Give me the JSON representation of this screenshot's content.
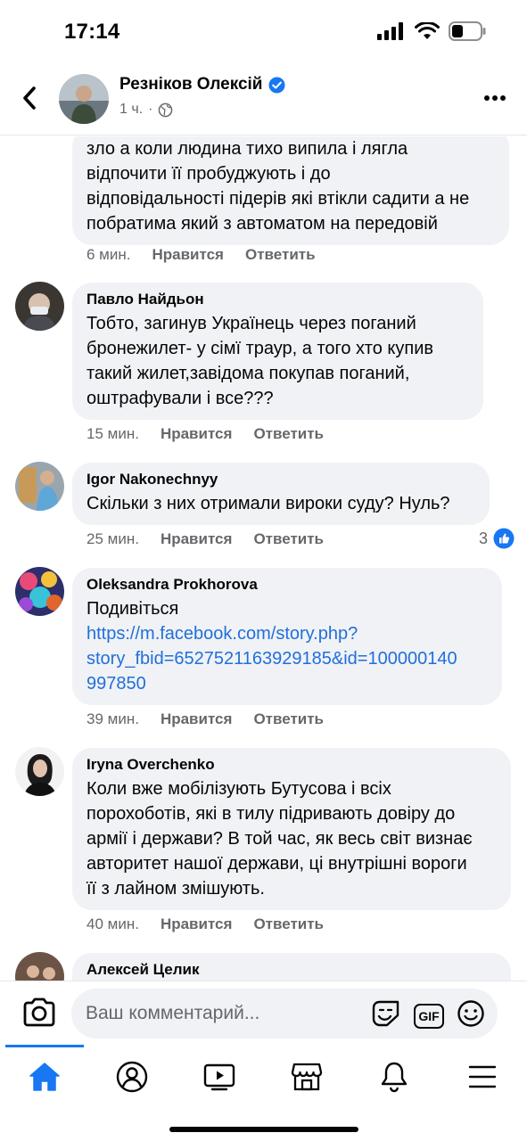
{
  "status_bar": {
    "time": "17:14"
  },
  "post_header": {
    "author": "Резніков Олексій",
    "time": "1 ч.",
    "separator": "·"
  },
  "colors": {
    "accent": "#1877f2",
    "link": "#216fdb",
    "bubble": "#f0f2f5",
    "muted": "#65676b"
  },
  "comments": [
    {
      "author": "",
      "text": "зло а коли людина тихо випила і лягла\nвідпочити її пробуджують і до\nвідповідальності підерів які втікли садити а не\nпобратима який з автоматом на передовій",
      "time": "6 мин.",
      "like_label": "Нравится",
      "reply_label": "Ответить"
    },
    {
      "author": "Павло Найдьон",
      "text": "Тобто, загинув Українець через поганий\nбронежилет-  у сімї траур, а того хто купив\nтакий жилет,завідома покупав поганий,\nоштрафували і все???",
      "time": "15 мин.",
      "like_label": "Нравится",
      "reply_label": "Ответить"
    },
    {
      "author": "Igor Nakonechnyy",
      "text": "Скільки з них отримали вироки суду? Нуль?",
      "time": "25 мин.",
      "like_label": "Нравится",
      "reply_label": "Ответить",
      "reaction_count": "3",
      "reaction_icon": "like-icon"
    },
    {
      "author": "Oleksandra Prokhorova",
      "text": "Подивіться",
      "link": "https://m.facebook.com/story.php?\nstory_fbid=6527521163929185&id=100000140\n997850",
      "time": "39 мин.",
      "like_label": "Нравится",
      "reply_label": "Ответить"
    },
    {
      "author": "Iryna Overchenko",
      "text": "Коли вже мобілізують Бутусова і всіх\nпорохоботів, які в тилу підривають довіру до\nармії і держави? В той час, як весь світ визнає\nавторитет нашої держави, ці внутрішні вороги\nїї з лайном змішують.",
      "time": "40 мин.",
      "like_label": "Нравится",
      "reply_label": "Ответить"
    },
    {
      "author": "Алексей Целик",
      "text": ""
    }
  ],
  "composer": {
    "placeholder": "Ваш комментарий...",
    "gif_label": "GIF"
  },
  "tabs": [
    {
      "name": "home",
      "icon": "home-icon",
      "active": true
    },
    {
      "name": "profile",
      "icon": "profile-icon"
    },
    {
      "name": "watch",
      "icon": "video-icon"
    },
    {
      "name": "marketplace",
      "icon": "store-icon"
    },
    {
      "name": "notifications",
      "icon": "bell-icon"
    },
    {
      "name": "menu",
      "icon": "menu-icon"
    }
  ]
}
